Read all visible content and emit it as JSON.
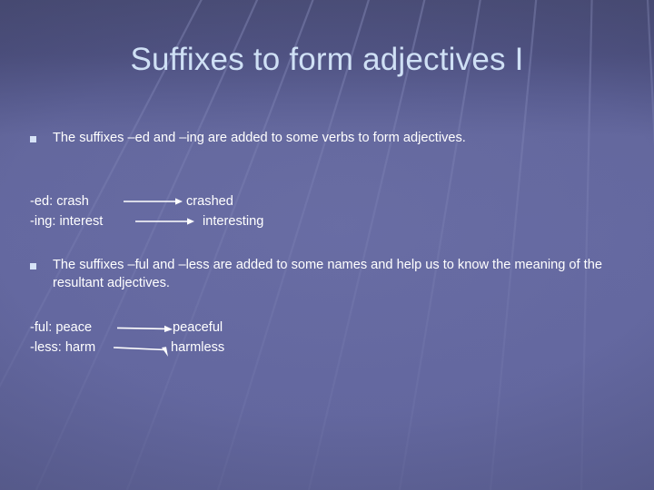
{
  "slide": {
    "title": "Suffixes to form adjectives I",
    "colors": {
      "background_top": "#4b4e78",
      "background_bottom": "#63679e",
      "grid_line": "#8b90c4",
      "title_text": "#cfe0f5",
      "body_text": "#ffffff",
      "bullet_marker": "#d7e3f7",
      "arrow": "#ffffff"
    },
    "bullets": [
      {
        "marker": "square-bullet",
        "text": "The suffixes –ed and –ing are added to some verbs to form adjectives."
      },
      {
        "marker": "square-bullet",
        "text": "The suffixes –ful and –less are added to some names and help us to know the meaning of the resultant adjectives."
      }
    ],
    "example_groups": [
      {
        "id": "ed-ing",
        "rows": [
          {
            "left": "-ed: crash",
            "arrow": "right-arrow",
            "right": "crashed"
          },
          {
            "left": "-ing: interest",
            "arrow": "right-arrow",
            "right": "interesting"
          }
        ]
      },
      {
        "id": "ful-less",
        "rows": [
          {
            "left": "-ful: peace",
            "arrow": "right-arrow",
            "right": "peaceful"
          },
          {
            "left": "-less: harm",
            "arrow": "right-arrow-down",
            "right": "harmless"
          }
        ]
      }
    ]
  }
}
